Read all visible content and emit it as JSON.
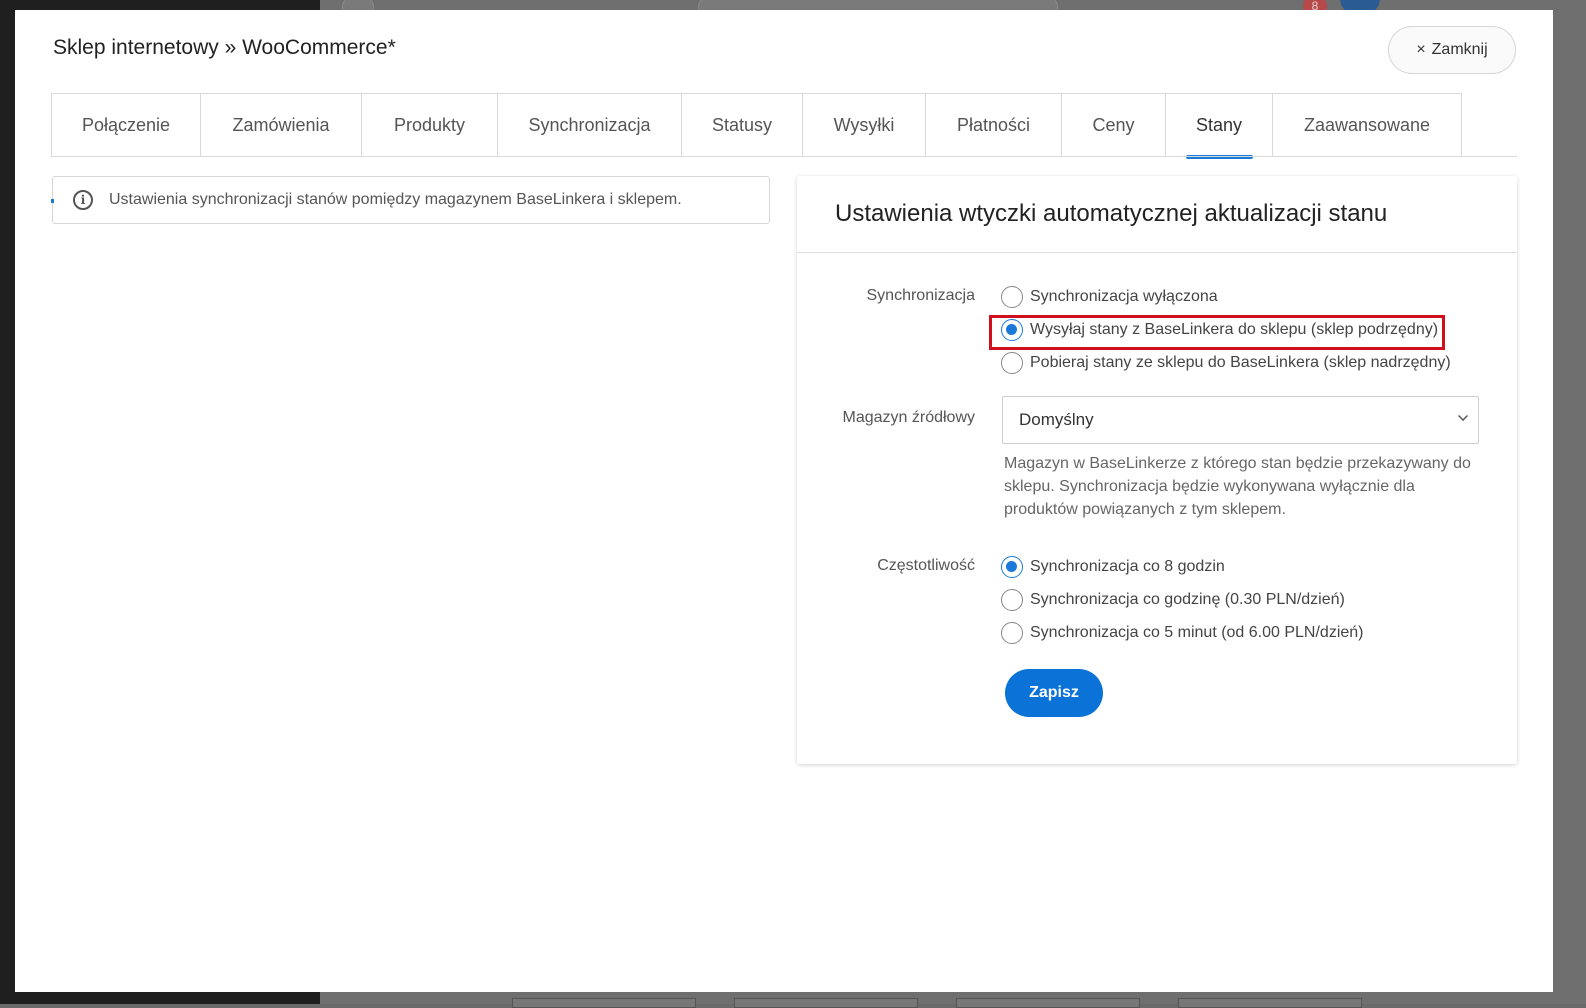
{
  "modal": {
    "title": "Sklep internetowy » WooCommerce*",
    "close_icon": "×",
    "close_label": "Zamknij"
  },
  "tabs": [
    {
      "label": "Połączenie"
    },
    {
      "label": "Zamówienia"
    },
    {
      "label": "Produkty"
    },
    {
      "label": "Synchronizacja"
    },
    {
      "label": "Statusy"
    },
    {
      "label": "Wysyłki"
    },
    {
      "label": "Płatności"
    },
    {
      "label": "Ceny"
    },
    {
      "label": "Stany",
      "active": true
    },
    {
      "label": "Zaawansowane"
    }
  ],
  "info": {
    "icon": "i",
    "text": "Ustawienia synchronizacji stanów pomiędzy magazynem BaseLinkera i sklepem."
  },
  "card": {
    "title": "Ustawienia wtyczki automatycznej aktualizacji stanu",
    "sync_label": "Synchronizacja",
    "sync_options": [
      {
        "label": "Synchronizacja wyłączona",
        "checked": false
      },
      {
        "label": "Wysyłaj stany z BaseLinkera do sklepu (sklep podrzędny)",
        "checked": true
      },
      {
        "label": "Pobieraj stany ze sklepu do BaseLinkera (sklep nadrzędny)",
        "checked": false
      }
    ],
    "warehouse_label": "Magazyn źródłowy",
    "warehouse_value": "Domyślny",
    "warehouse_help": "Magazyn w BaseLinkerze z którego stan będzie przekazywany do sklepu. Synchronizacja będzie wykonywana wyłącznie dla produktów powiązanych z tym sklepem.",
    "freq_label": "Częstotliwość",
    "freq_options": [
      {
        "label": "Synchronizacja co 8 godzin",
        "checked": true
      },
      {
        "label": "Synchronizacja co godzinę (0.30 PLN/dzień)",
        "checked": false
      },
      {
        "label": "Synchronizacja co 5 minut (od 6.00 PLN/dzień)",
        "checked": false
      }
    ],
    "save_label": "Zapisz"
  },
  "background": {
    "badge_count": "8"
  },
  "colors": {
    "accent": "#1a7ad9",
    "button": "#0b72d7",
    "highlight": "#d0101c"
  }
}
